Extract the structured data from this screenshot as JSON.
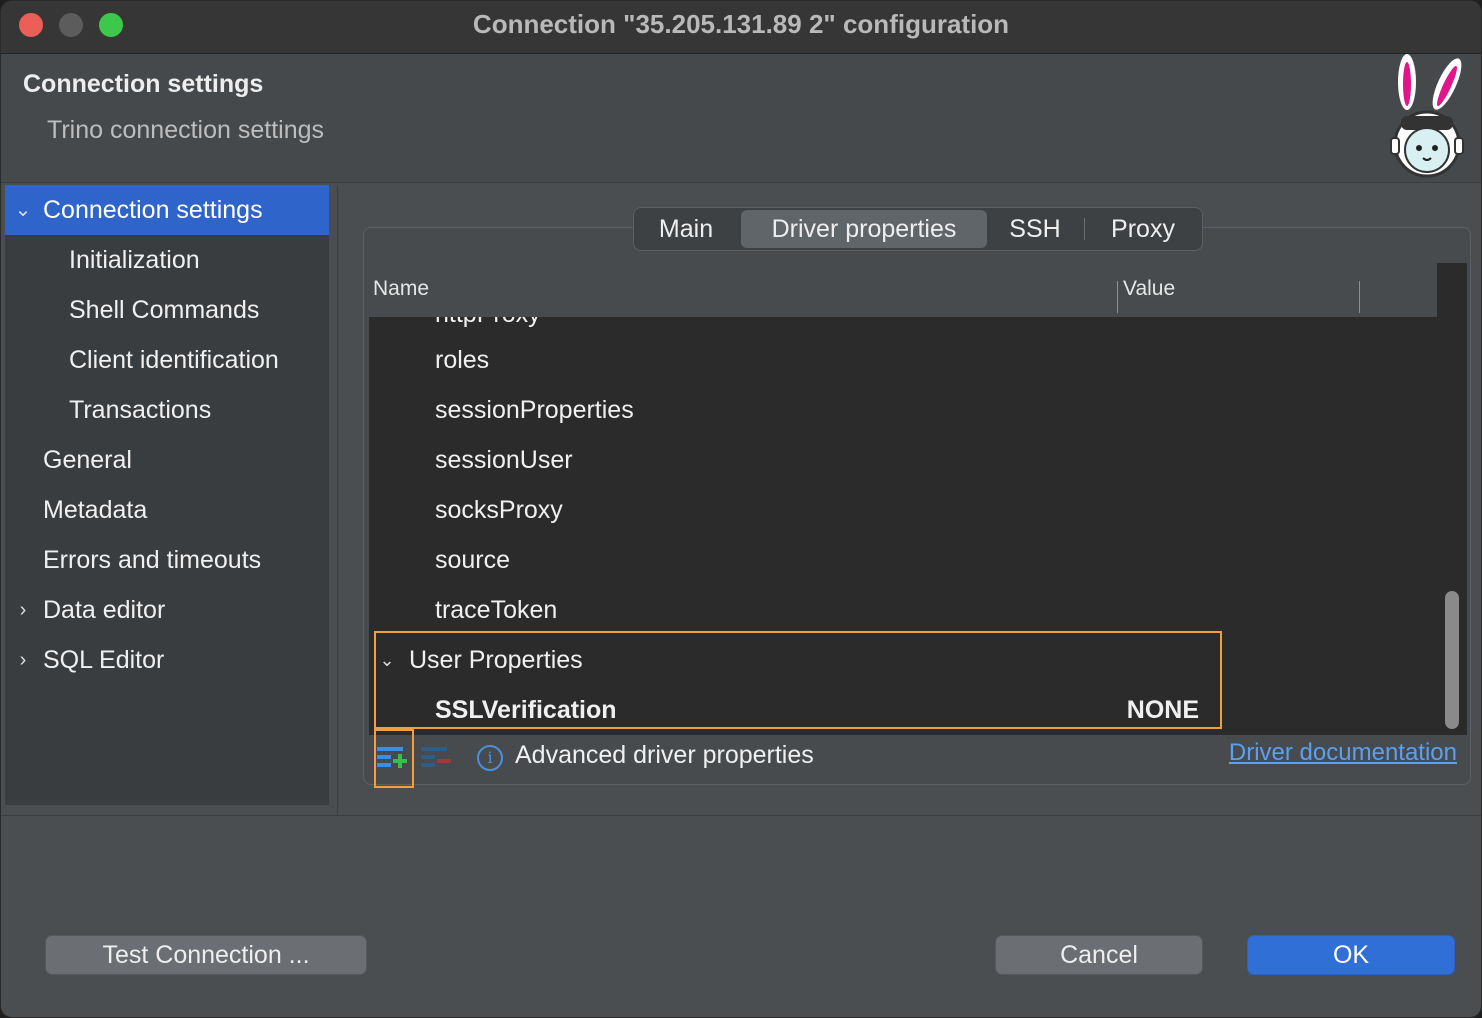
{
  "window": {
    "title": "Connection \"35.205.131.89 2\" configuration"
  },
  "header": {
    "title": "Connection settings",
    "subtitle": "Trino connection settings",
    "logo_icon": "dbeaver-bunny-logo"
  },
  "sidebar": {
    "items": [
      {
        "label": "Connection settings",
        "selected": true,
        "expanded": true
      },
      {
        "label": "Initialization"
      },
      {
        "label": "Shell Commands"
      },
      {
        "label": "Client identification"
      },
      {
        "label": "Transactions"
      },
      {
        "label": "General"
      },
      {
        "label": "Metadata"
      },
      {
        "label": "Errors and timeouts"
      },
      {
        "label": "Data editor",
        "expandable": true
      },
      {
        "label": "SQL Editor",
        "expandable": true
      }
    ]
  },
  "tabs": [
    {
      "label": "Main"
    },
    {
      "label": "Driver properties",
      "active": true
    },
    {
      "label": "SSH"
    },
    {
      "label": "Proxy"
    }
  ],
  "table": {
    "columns": {
      "name": "Name",
      "value": "Value"
    },
    "rows": [
      {
        "name": "httpProxy",
        "value": ""
      },
      {
        "name": "roles",
        "value": ""
      },
      {
        "name": "sessionProperties",
        "value": ""
      },
      {
        "name": "sessionUser",
        "value": ""
      },
      {
        "name": "socksProxy",
        "value": ""
      },
      {
        "name": "source",
        "value": ""
      },
      {
        "name": "traceToken",
        "value": ""
      }
    ],
    "user_group": {
      "label": "User Properties",
      "expanded": true,
      "rows": [
        {
          "name": "SSLVerification",
          "value": "NONE"
        }
      ]
    }
  },
  "toolbar": {
    "add_icon": "add-property-icon",
    "remove_icon": "remove-property-icon",
    "info_icon_glyph": "i",
    "advanced_label": "Advanced driver properties",
    "doc_link": "Driver documentation"
  },
  "buttons": {
    "test": "Test Connection ...",
    "cancel": "Cancel",
    "ok": "OK"
  },
  "colors": {
    "accent": "#2f65ca",
    "highlight": "#f0a040",
    "link": "#5aa0f0"
  }
}
